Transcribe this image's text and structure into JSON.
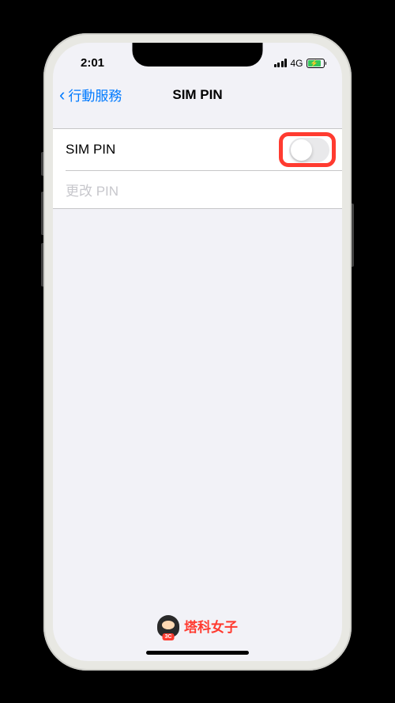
{
  "status_bar": {
    "time": "2:01",
    "network": "4G"
  },
  "nav": {
    "back_label": "行動服務",
    "title": "SIM PIN"
  },
  "settings": {
    "sim_pin_label": "SIM PIN",
    "sim_pin_enabled": false,
    "change_pin_label": "更改 PIN"
  },
  "watermark": {
    "badge": "3C",
    "text": "塔科女子"
  }
}
